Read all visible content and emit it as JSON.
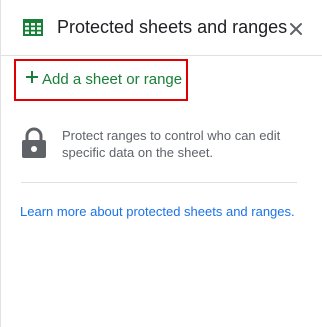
{
  "header": {
    "title": "Protected sheets and ranges",
    "icon": "sheets-grid-icon",
    "close_icon": "close-icon",
    "icon_color": "#188038"
  },
  "actions": {
    "add_label": "Add a sheet or range",
    "add_icon": "plus-icon",
    "accent_color": "#188038",
    "highlight_color": "#e00000"
  },
  "info": {
    "icon": "lock-icon",
    "text": "Protect ranges to control who can edit specific data on the sheet."
  },
  "footer": {
    "learn_more": "Learn more about protected sheets and ranges.",
    "link_color": "#1a73e8"
  }
}
